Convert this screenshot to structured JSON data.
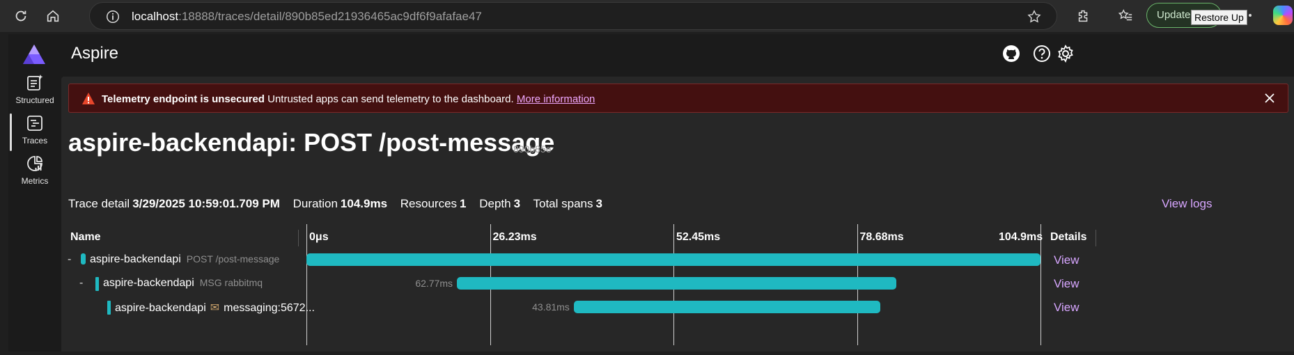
{
  "browser": {
    "url_host": "localhost",
    "url_path": ":18888/traces/detail/890b85ed21936465ac9df6f9afafae47",
    "update_label": "Update",
    "tooltip": "Restore Up"
  },
  "app": {
    "title": "Aspire",
    "nav": [
      {
        "label": "Structured",
        "icon": "structured-logs-icon"
      },
      {
        "label": "Traces",
        "icon": "traces-icon"
      },
      {
        "label": "Metrics",
        "icon": "metrics-icon"
      }
    ]
  },
  "banner": {
    "title": "Telemetry endpoint is unsecured",
    "message": "Untrusted apps can send telemetry to the dashboard.",
    "link": "More information"
  },
  "page": {
    "title": "aspire-backendapi: POST /post-message",
    "trace_id": "890b85e"
  },
  "summary": {
    "trace_detail_label": "Trace detail",
    "trace_detail_value": "3/29/2025 10:59:01.709 PM",
    "duration_label": "Duration",
    "duration_value": "104.9ms",
    "resources_label": "Resources",
    "resources_value": "1",
    "depth_label": "Depth",
    "depth_value": "3",
    "total_spans_label": "Total spans",
    "total_spans_value": "3",
    "view_logs": "View logs"
  },
  "grid": {
    "name_header": "Name",
    "details_header": "Details",
    "ticks": [
      "0μs",
      "26.23ms",
      "52.45ms",
      "78.68ms",
      "104.9ms"
    ],
    "total_ms": 104.9,
    "rows": [
      {
        "toggle": "-",
        "name": "aspire-backendapi",
        "sub": "POST /post-message",
        "start_ms": 0,
        "duration_ms": 104.9,
        "duration_label": "",
        "view": "View"
      },
      {
        "toggle": "-",
        "name": "aspire-backendapi",
        "sub": "MSG rabbitmq",
        "start_ms": 21.5,
        "duration_ms": 62.77,
        "duration_label": "62.77ms",
        "view": "View"
      },
      {
        "toggle": "",
        "name": "aspire-backendapi",
        "sub": "messaging:5672...",
        "start_ms": 38.2,
        "duration_ms": 43.81,
        "duration_label": "43.81ms",
        "view": "View"
      }
    ]
  },
  "colors": {
    "span_bar": "#1fb9c1",
    "link": "#d7a6ff",
    "banner_bg": "#441010"
  }
}
